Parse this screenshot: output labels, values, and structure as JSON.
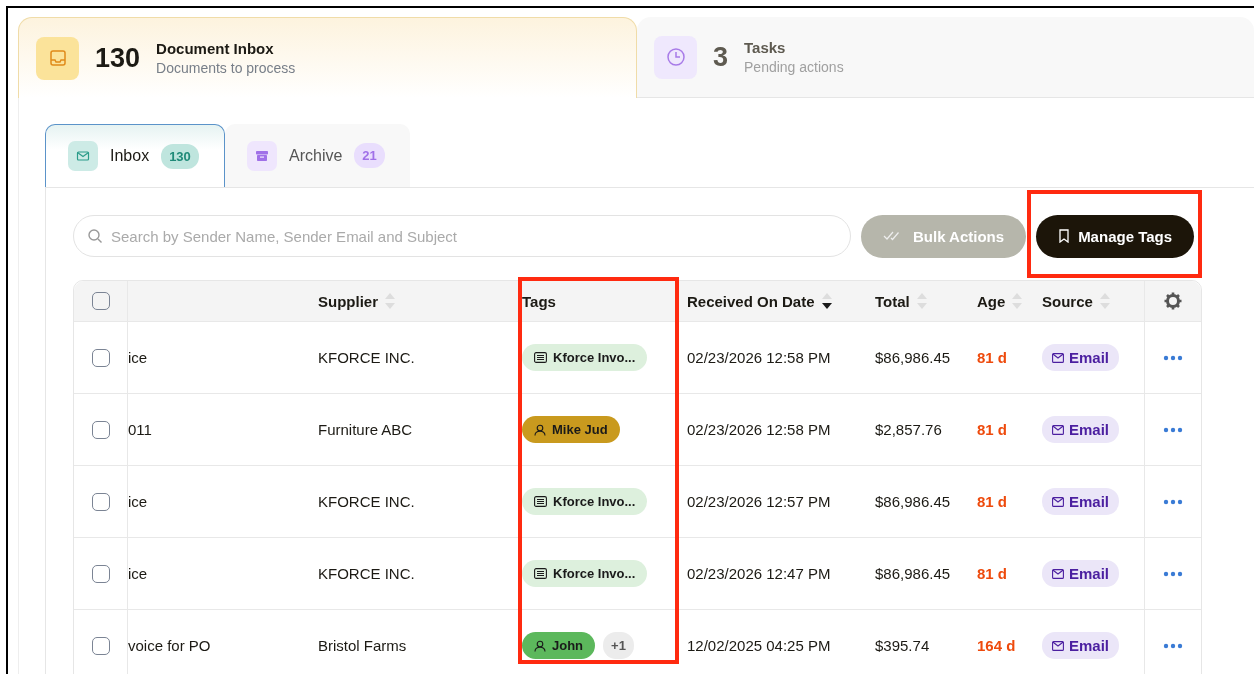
{
  "summary_cards": [
    {
      "kind": "inbox",
      "count": "130",
      "title": "Document Inbox",
      "subtitle": "Documents to process",
      "selected": true
    },
    {
      "kind": "tasks",
      "count": "3",
      "title": "Tasks",
      "subtitle": "Pending actions",
      "selected": false
    }
  ],
  "tabs": [
    {
      "kind": "inbox",
      "label": "Inbox",
      "count": "130",
      "selected": true
    },
    {
      "kind": "archive",
      "label": "Archive",
      "count": "21",
      "selected": false
    }
  ],
  "search": {
    "placeholder": "Search by Sender Name, Sender Email and Subject"
  },
  "buttons": [
    {
      "kind": "bulk",
      "label": "Bulk Actions",
      "disabled": true,
      "highlighted": false
    },
    {
      "kind": "tags",
      "label": "Manage Tags",
      "disabled": false,
      "highlighted": true
    }
  ],
  "table": {
    "all_checked": false,
    "columns": [
      {
        "label": "Supplier",
        "sortable": true,
        "sort_descending": false,
        "highlighted": false
      },
      {
        "label": "Tags",
        "sortable": false,
        "highlighted": true
      },
      {
        "label": "Received On Date",
        "sortable": true,
        "sort_descending": true,
        "highlighted": false
      },
      {
        "label": "Total",
        "sortable": true,
        "sort_descending": false,
        "highlighted": false
      },
      {
        "label": "Age",
        "sortable": true,
        "sort_descending": false,
        "highlighted": false
      },
      {
        "label": "Source",
        "sortable": true,
        "sort_descending": false,
        "highlighted": false
      }
    ],
    "rows": [
      {
        "checked": false,
        "column_1": "ice",
        "supplier": "KFORCE INC.",
        "tags": [
          {
            "kind": "document",
            "label": "Kforce Invo...",
            "color": "#ddf0dd"
          }
        ],
        "received": "02/23/2026 12:58 PM",
        "total": "$86,986.45",
        "age": "81 d",
        "source": "Email"
      },
      {
        "checked": false,
        "column_1": "011",
        "supplier": "Furniture ABC",
        "tags": [
          {
            "kind": "person",
            "label": "Mike Jud",
            "color": "#c99a1e"
          }
        ],
        "received": "02/23/2026 12:58 PM",
        "total": "$2,857.76",
        "age": "81 d",
        "source": "Email"
      },
      {
        "checked": false,
        "column_1": "ice",
        "supplier": "KFORCE INC.",
        "tags": [
          {
            "kind": "document",
            "label": "Kforce Invo...",
            "color": "#ddf0dd"
          }
        ],
        "received": "02/23/2026 12:57 PM",
        "total": "$86,986.45",
        "age": "81 d",
        "source": "Email"
      },
      {
        "checked": false,
        "column_1": "ice",
        "supplier": "KFORCE INC.",
        "tags": [
          {
            "kind": "document",
            "label": "Kforce Invo...",
            "color": "#ddf0dd"
          }
        ],
        "received": "02/23/2026 12:47 PM",
        "total": "$86,986.45",
        "age": "81 d",
        "source": "Email"
      },
      {
        "checked": false,
        "column_1": "voice for PO",
        "supplier": "Bristol Farms",
        "tags": [
          {
            "kind": "person",
            "label": "John",
            "color": "#5cb85c"
          }
        ],
        "more_tags": "+1",
        "received": "12/02/2025 04:25 PM",
        "total": "$395.74",
        "age": "164 d",
        "source": "Email"
      }
    ]
  }
}
